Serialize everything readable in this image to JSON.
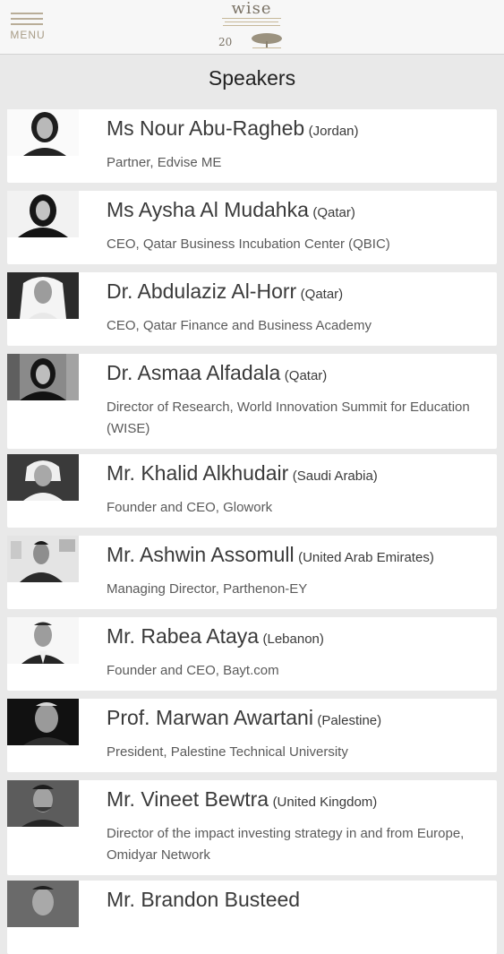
{
  "header": {
    "menu_label": "MENU",
    "logo_text": "wise",
    "logo_number": "20"
  },
  "page_title": "Speakers",
  "speakers": [
    {
      "name": "Ms Nour Abu-Ragheb",
      "country": "(Jordan)",
      "role": "Partner, Edvise ME"
    },
    {
      "name": "Ms Aysha Al Mudahka",
      "country": "(Qatar)",
      "role": "CEO, Qatar Business Incubation Center (QBIC)"
    },
    {
      "name": "Dr. Abdulaziz Al-Horr",
      "country": "(Qatar)",
      "role": "CEO, Qatar Finance and Business Academy"
    },
    {
      "name": "Dr. Asmaa Alfadala",
      "country": "(Qatar)",
      "role": "Director of Research, World Innovation Summit for Education (WISE)"
    },
    {
      "name": "Mr. Khalid Alkhudair",
      "country": "(Saudi Arabia)",
      "role": "Founder and CEO, Glowork"
    },
    {
      "name": "Mr. Ashwin Assomull",
      "country": "(United Arab Emirates)",
      "role": "Managing Director, Parthenon-EY"
    },
    {
      "name": "Mr. Rabea Ataya",
      "country": "(Lebanon)",
      "role": "Founder and CEO, Bayt.com"
    },
    {
      "name": "Prof. Marwan Awartani",
      "country": "(Palestine)",
      "role": "President, Palestine Technical University"
    },
    {
      "name": "Mr. Vineet Bewtra",
      "country": "(United Kingdom)",
      "role": "Director of the impact investing strategy in and from Europe, Omidyar Network"
    },
    {
      "name": "Mr. Brandon Busteed",
      "country": "",
      "role": ""
    }
  ]
}
